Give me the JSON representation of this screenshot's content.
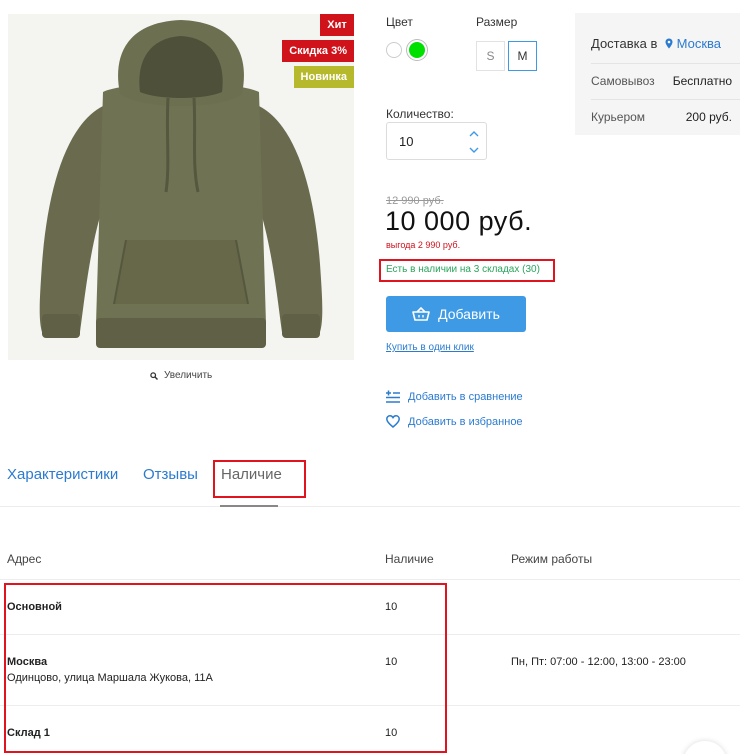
{
  "product": {
    "badges": [
      "Хит",
      "Скидка 3%",
      "Новинка"
    ],
    "zoom_label": "Увеличить"
  },
  "options": {
    "color_label": "Цвет",
    "size_label": "Размер",
    "sizes": [
      "S",
      "M"
    ],
    "selected_size": "M",
    "colors": [
      "#ffffff",
      "#00e000"
    ],
    "selected_color": "#00e000",
    "quantity_label": "Количество:",
    "quantity_value": "10"
  },
  "pricing": {
    "old_price": "12 990 руб.",
    "price": "10 000 руб.",
    "savings": "выгода 2 990 руб.",
    "stock_status": "Есть в наличии на 3 складах (30)"
  },
  "actions": {
    "add_button": "Добавить",
    "one_click": "Купить в один клик",
    "compare": "Добавить в сравнение",
    "favorites": "Добавить в избранное"
  },
  "delivery": {
    "title": "Доставка в",
    "city": "Москва",
    "rows": [
      {
        "label": "Самовывоз",
        "value": "Бесплатно"
      },
      {
        "label": "Курьером",
        "value": "200 руб."
      }
    ]
  },
  "tabs": [
    "Характеристики",
    "Отзывы",
    "Наличие"
  ],
  "active_tab": "Наличие",
  "availability": {
    "headers": [
      "Адрес",
      "Наличие",
      "Режим работы"
    ],
    "rows": [
      {
        "name": "Основной",
        "address": "",
        "qty": "10",
        "hours": ""
      },
      {
        "name": "Москва",
        "address": "Одинцово, улица Маршала Жукова, 11А",
        "qty": "10",
        "hours": "Пн, Пт: 07:00 - 12:00, 13:00 - 23:00"
      },
      {
        "name": "Склад 1",
        "address": "",
        "qty": "10",
        "hours": ""
      }
    ]
  },
  "colors": {
    "accent": "#3e9ae4",
    "link": "#2b7bcf",
    "badge_red": "#d0121b",
    "badge_new": "#b6b92b",
    "in_stock": "#2aa55c",
    "highlight": "#e0141e"
  }
}
